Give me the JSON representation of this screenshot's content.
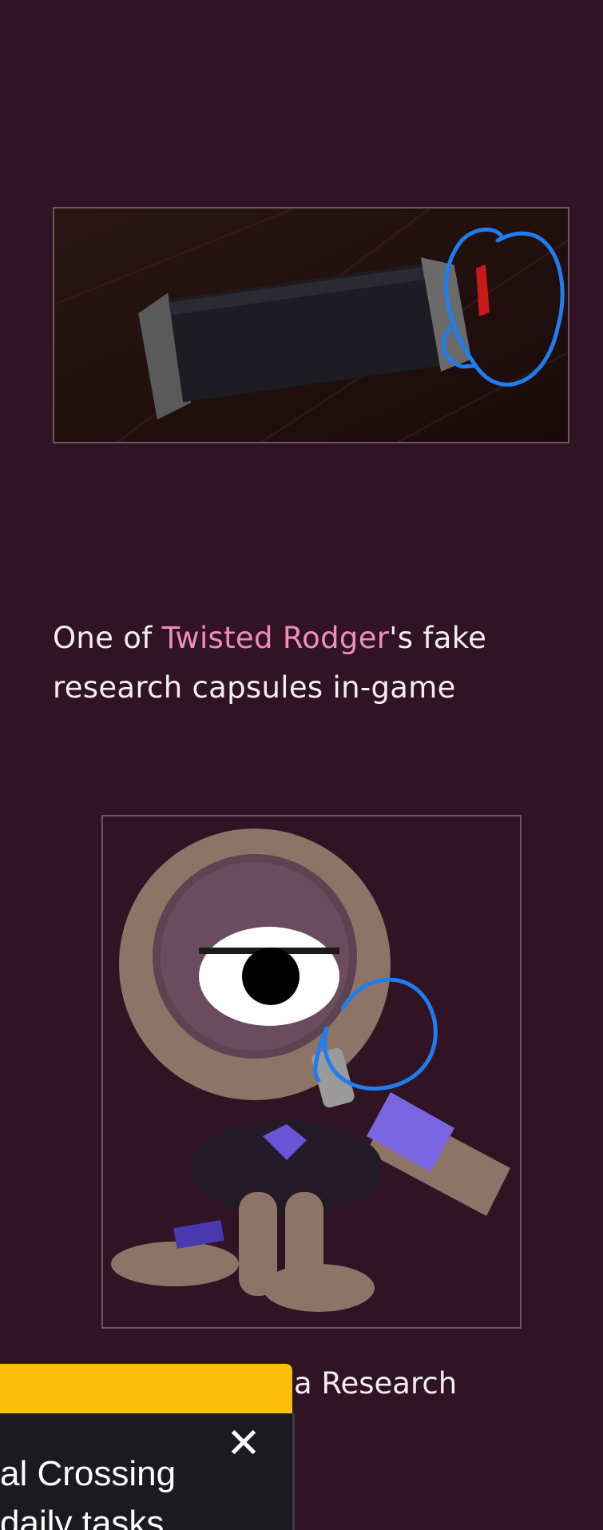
{
  "article": {
    "caption_prefix": "One of ",
    "caption_link": "Twisted Rodger",
    "caption_suffix": "'s fake research capsules in-game",
    "caption2_partial": "a Research"
  },
  "popup": {
    "text": "imal Crossing\ndaily tasks",
    "line1": "al Crossing",
    "line2": "daily tasks",
    "close_glyph": "✕"
  },
  "colors": {
    "background": "#311423",
    "link": "#f08cbe",
    "banner_yellow": "#fcc00a",
    "annotation_blue": "#1e7df0"
  }
}
